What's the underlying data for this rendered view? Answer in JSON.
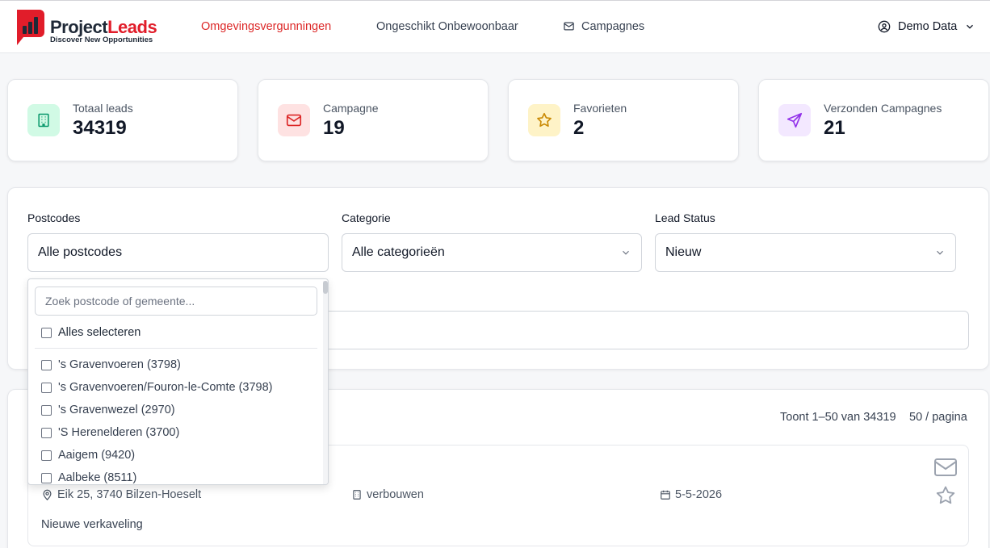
{
  "brand": {
    "name_part1": "Project",
    "name_part2": "Leads",
    "tagline": "Discover New Opportunities",
    "primary_color": "#e11d2a"
  },
  "nav": {
    "links": [
      {
        "label": "Omgevingsvergunningen",
        "active": true
      },
      {
        "label": "Ongeschikt Onbewoonbaar",
        "active": false
      },
      {
        "label": "Campagnes",
        "icon": "mail-icon",
        "active": false
      }
    ],
    "user": {
      "label": "Demo Data",
      "icon": "user-circle-icon"
    }
  },
  "stats": [
    {
      "label": "Totaal leads",
      "value": "34319",
      "icon": "building-icon",
      "color": "#059669",
      "bg": "#d1fae5"
    },
    {
      "label": "Campagne",
      "value": "19",
      "icon": "mail-icon",
      "color": "#dc2626",
      "bg": "#fee2e2"
    },
    {
      "label": "Favorieten",
      "value": "2",
      "icon": "star-icon",
      "color": "#ca8a04",
      "bg": "#fef3c7"
    },
    {
      "label": "Verzonden Campagnes",
      "value": "21",
      "icon": "send-icon",
      "color": "#9333ea",
      "bg": "#f3e8ff"
    }
  ],
  "filters": {
    "postcodes": {
      "label": "Postcodes",
      "value": "Alle postcodes"
    },
    "categorie": {
      "label": "Categorie",
      "value": "Alle categorieën"
    },
    "lead_status": {
      "label": "Lead Status",
      "value": "Nieuw"
    }
  },
  "postcode_dropdown": {
    "search_placeholder": "Zoek postcode of gemeente...",
    "select_all": "Alles selecteren",
    "items": [
      "'s Gravenvoeren (3798)",
      "'s Gravenvoeren/Fouron-le-Comte (3798)",
      "'s Gravenwezel (2970)",
      "'S Herenelderen (3700)",
      "Aaigem (9420)",
      "Aalbeke (8511)"
    ]
  },
  "results": {
    "showing": "Toont 1–50 van 34319",
    "per_page": "50 / pagina"
  },
  "lead": {
    "address": "Eik 25, 3740 Bilzen-Hoeselt",
    "category": "verbouwen",
    "date": "5-5-2026",
    "description": "Nieuwe verkaveling"
  }
}
